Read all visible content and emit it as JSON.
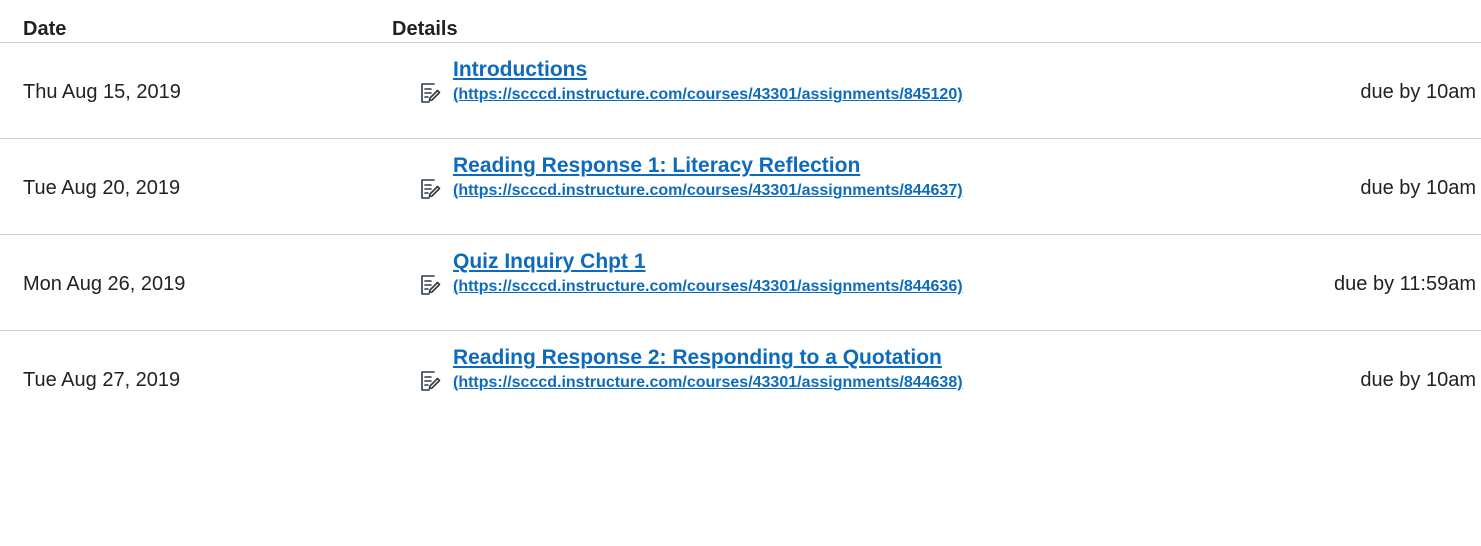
{
  "header": {
    "date_label": "Date",
    "details_label": "Details"
  },
  "rows": [
    {
      "date": "Thu Aug 15, 2019",
      "icon": "assignment-icon",
      "title": "Introductions",
      "url": "(https://scccd.instructure.com/courses/43301/assignments/845120)",
      "due": "due by 10am"
    },
    {
      "date": "Tue Aug 20, 2019",
      "icon": "assignment-icon",
      "title": "Reading Response 1: Literacy Reflection",
      "url": "(https://scccd.instructure.com/courses/43301/assignments/844637)",
      "due": "due by 10am"
    },
    {
      "date": "Mon Aug 26, 2019",
      "icon": "assignment-icon",
      "title": "Quiz Inquiry Chpt 1",
      "url": "(https://scccd.instructure.com/courses/43301/assignments/844636)",
      "due": "due by 11:59am"
    },
    {
      "date": "Tue Aug 27, 2019",
      "icon": "assignment-icon",
      "title": "Reading Response 2: Responding to a Quotation",
      "url": "(https://scccd.instructure.com/courses/43301/assignments/844638)",
      "due": "due by 10am"
    }
  ],
  "colors": {
    "link": "#0d6bbd",
    "text": "#222222",
    "divider": "#c7cdd1"
  }
}
